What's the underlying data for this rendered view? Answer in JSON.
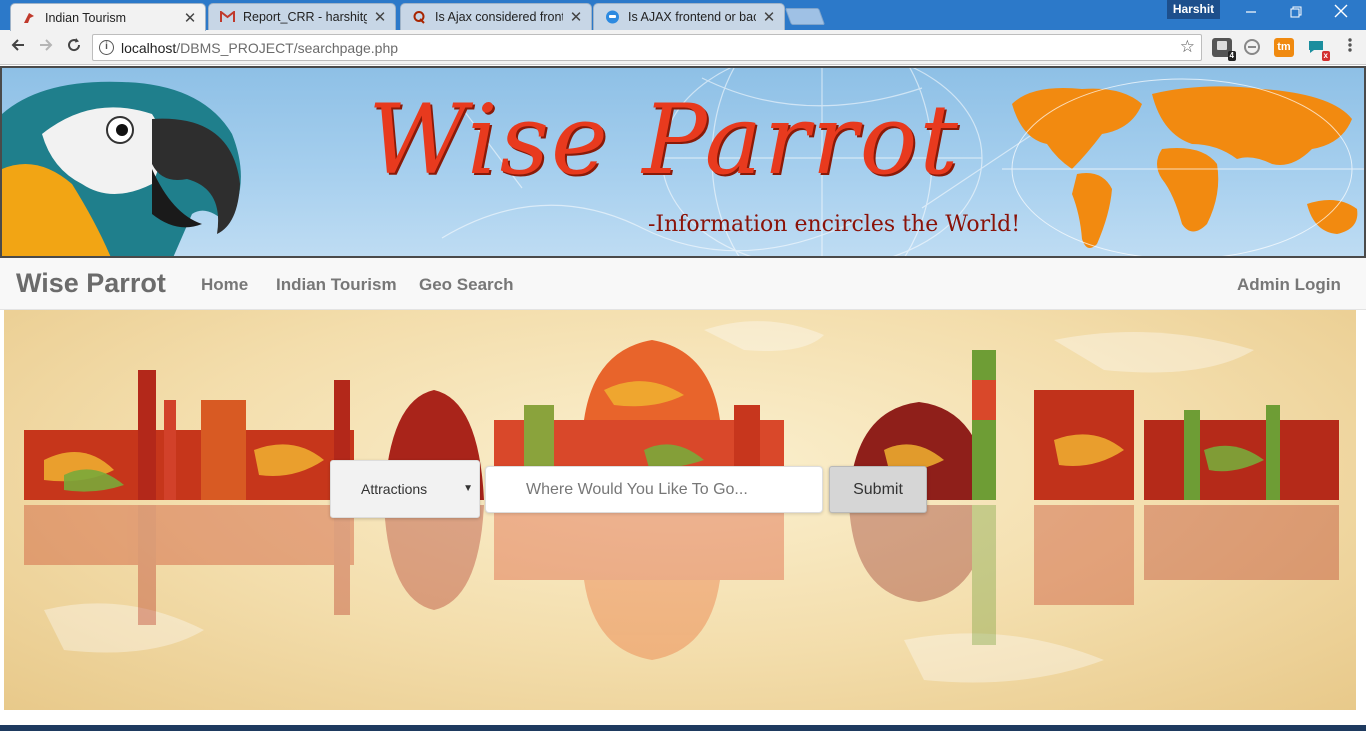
{
  "browser": {
    "tabs": [
      {
        "title": "Indian Tourism",
        "favicon": "parrot-favicon",
        "active": true
      },
      {
        "title": "Report_CRR - harshitguj",
        "favicon": "gmail-icon",
        "active": false
      },
      {
        "title": "Is Ajax considered front-",
        "favicon": "quora-icon",
        "active": false
      },
      {
        "title": "Is AJAX frontend or back",
        "favicon": "chat-bubble-icon",
        "active": false
      }
    ],
    "close_glyph": "✕",
    "profile_name": "Harshit",
    "url_host": "localhost",
    "url_path": "/DBMS_PROJECT/searchpage.php",
    "extensions": [
      {
        "icon": "puzzle-ext-icon",
        "badge": "4"
      },
      {
        "icon": "circle-ext-icon",
        "badge": ""
      },
      {
        "icon": "tm-ext-icon",
        "badge": ""
      },
      {
        "icon": "chat-ext-icon",
        "badge": "x"
      }
    ],
    "ext_labels": {
      "tm": "tm"
    }
  },
  "banner": {
    "brand": "Wise Parrot",
    "tagline": "-Information encircles the World!"
  },
  "nav": {
    "brand": "Wise Parrot",
    "links": [
      "Home",
      "Indian Tourism",
      "Geo Search"
    ],
    "admin": "Admin Login"
  },
  "search": {
    "category": "Attractions",
    "placeholder": "Where Would You Like To Go...",
    "submit": "Submit"
  },
  "colors": {
    "chrome_blue": "#2c79c9",
    "brand_red": "#e83a1e",
    "map_orange": "#f28a10"
  }
}
